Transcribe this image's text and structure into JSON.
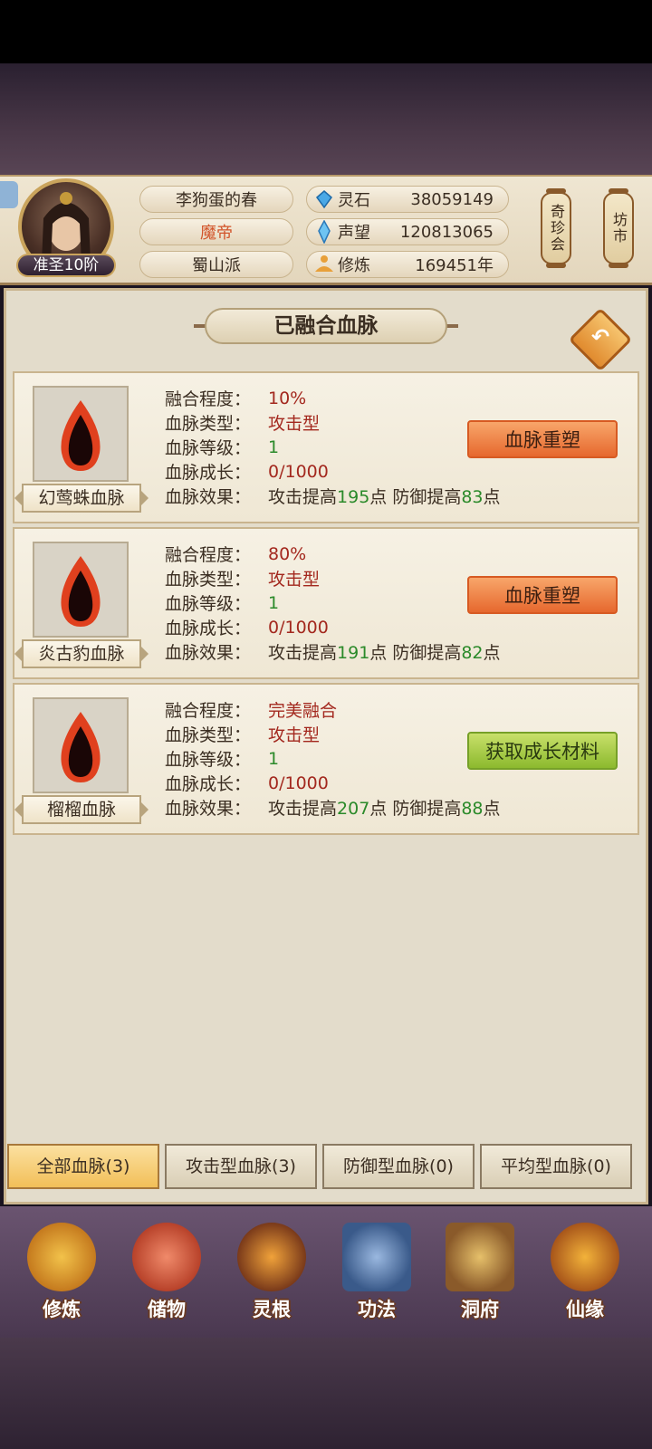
{
  "player": {
    "name": "李狗蛋的春",
    "title": "魔帝",
    "sect": "蜀山派",
    "rank": "准圣10阶"
  },
  "stats": [
    {
      "icon": "spirit-stone-icon",
      "label": "灵石",
      "value": "38059149"
    },
    {
      "icon": "prestige-crystal-icon",
      "label": "声望",
      "value": "120813065"
    },
    {
      "icon": "meditation-icon",
      "label": "修炼",
      "value": "169451年"
    }
  ],
  "lanterns": {
    "treasure": "奇珍会",
    "market": "坊市"
  },
  "panel": {
    "title": "已融合血脉"
  },
  "field_labels": {
    "fusion": "融合程度：",
    "type": "血脉类型：",
    "level": "血脉等级：",
    "growth": "血脉成长：",
    "effect": "血脉效果："
  },
  "bloodlines": [
    {
      "name": "幻莺蛛血脉",
      "fusion": "10%",
      "type": "攻击型",
      "level": "1",
      "growth": "0/1000",
      "effect_atk_prefix": "攻击提高",
      "effect_atk_value": "195",
      "effect_atk_suffix": "点 防御提高",
      "effect_def_value": "83",
      "effect_def_suffix": "点",
      "action": "血脉重塑"
    },
    {
      "name": "炎古豹血脉",
      "fusion": "80%",
      "type": "攻击型",
      "level": "1",
      "growth": "0/1000",
      "effect_atk_prefix": "攻击提高",
      "effect_atk_value": "191",
      "effect_atk_suffix": "点 防御提高",
      "effect_def_value": "82",
      "effect_def_suffix": "点",
      "action": "血脉重塑"
    },
    {
      "name": "榴榴血脉",
      "fusion": "完美融合",
      "type": "攻击型",
      "level": "1",
      "growth": "0/1000",
      "effect_atk_prefix": "攻击提高",
      "effect_atk_value": "207",
      "effect_atk_suffix": "点 防御提高",
      "effect_def_value": "88",
      "effect_def_suffix": "点",
      "action": "获取成长材料"
    }
  ],
  "filters": [
    {
      "label": "全部血脉(3)",
      "active": true
    },
    {
      "label": "攻击型血脉(3)",
      "active": false
    },
    {
      "label": "防御型血脉(0)",
      "active": false
    },
    {
      "label": "平均型血脉(0)",
      "active": false
    }
  ],
  "nav": [
    {
      "icon": "cultivate-icon",
      "label": "修炼"
    },
    {
      "icon": "storage-bag-icon",
      "label": "储物"
    },
    {
      "icon": "spirit-root-icon",
      "label": "灵根"
    },
    {
      "icon": "technique-book-icon",
      "label": "功法"
    },
    {
      "icon": "cave-mansion-icon",
      "label": "洞府"
    },
    {
      "icon": "fate-gourd-icon",
      "label": "仙缘"
    }
  ],
  "colors": {
    "accent_red": "#a3281e",
    "accent_green": "#2b8a2a",
    "button_orange": "#e6682e",
    "button_green": "#8cba2e"
  }
}
